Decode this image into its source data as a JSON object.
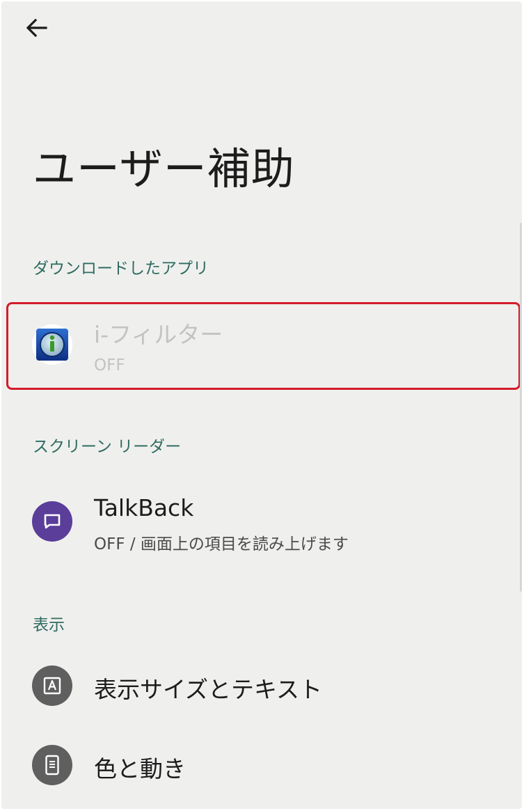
{
  "header": {
    "back_icon": "arrow-back-icon",
    "title": "ユーザー補助"
  },
  "sections": [
    {
      "header": "ダウンロードしたアプリ",
      "items": [
        {
          "title": "i-フィルター",
          "summary": "OFF",
          "icon": "i-filter-app-icon",
          "enabled": false,
          "highlighted": true
        }
      ]
    },
    {
      "header": "スクリーン リーダー",
      "items": [
        {
          "title": "TalkBack",
          "summary": "OFF / 画面上の項目を読み上げます",
          "icon": "talkback-chat-icon",
          "icon_color": "#5a3e9a"
        }
      ]
    },
    {
      "header": "表示",
      "items": [
        {
          "title": "表示サイズとテキスト",
          "icon": "text-size-icon",
          "icon_color": "#5e5f5e"
        },
        {
          "title": "色と動き",
          "icon": "phone-color-icon",
          "icon_color": "#5e5f5e"
        }
      ]
    }
  ],
  "colors": {
    "background": "#eff0ee",
    "section_header": "#2f6b60",
    "highlight": "#d51b2b",
    "disabled_text": "#c2c3c2"
  }
}
